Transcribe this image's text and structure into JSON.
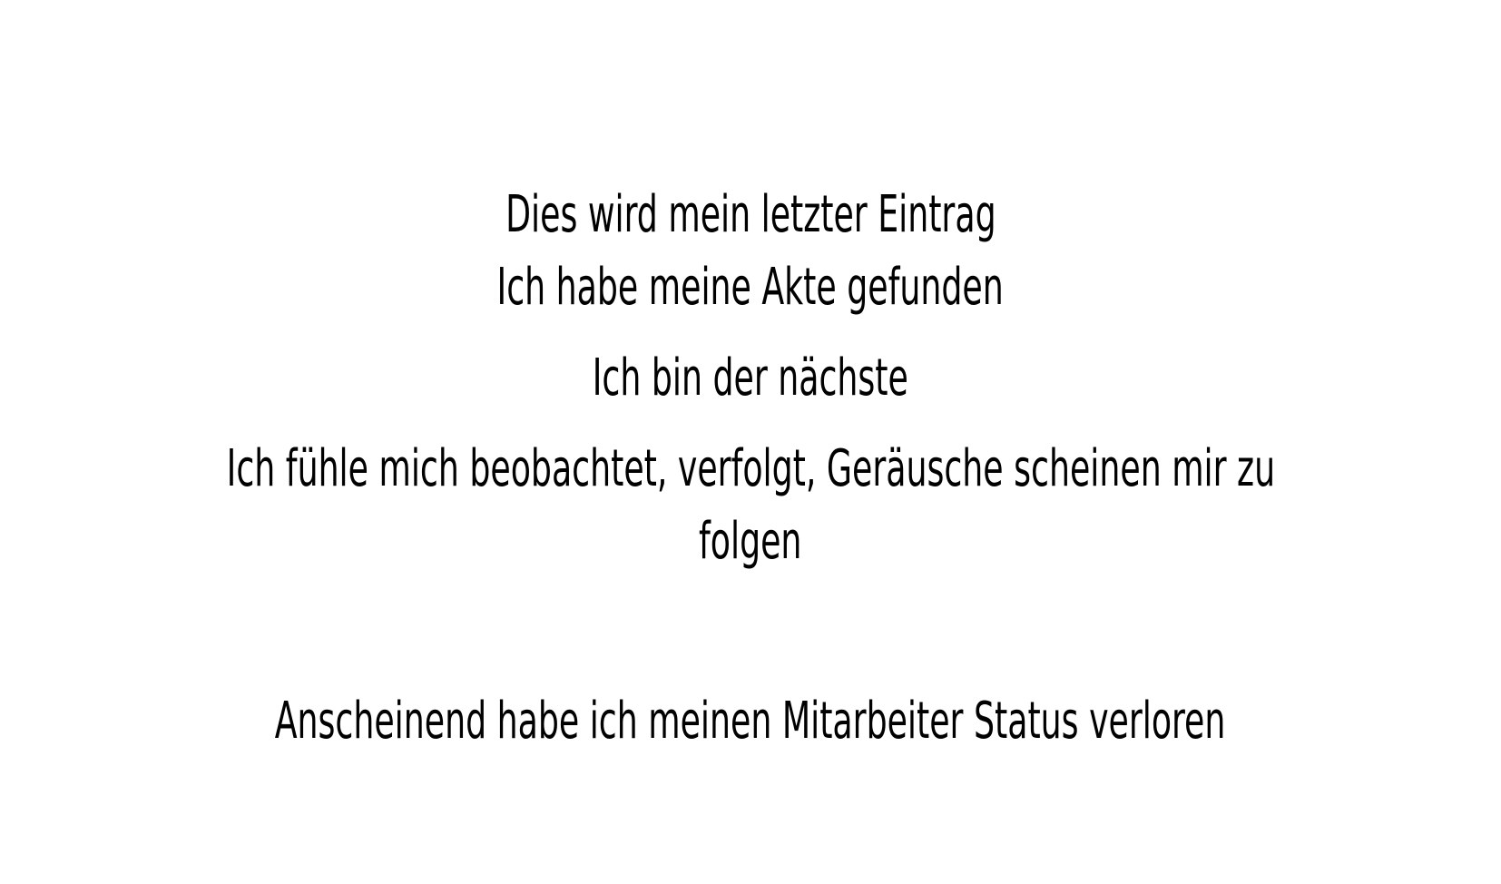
{
  "text": {
    "line1": "Dies wird mein letzter Eintrag",
    "line2": "Ich habe meine Akte gefunden",
    "line3": "Ich bin der nächste",
    "line4": "Ich fühle mich beobachtet, verfolgt, Geräusche scheinen mir zu",
    "line5": "folgen",
    "line6": "Anscheinend habe ich meinen Mitarbeiter Status verloren"
  },
  "colors": {
    "background": "#ffffff",
    "text": "#000000"
  }
}
